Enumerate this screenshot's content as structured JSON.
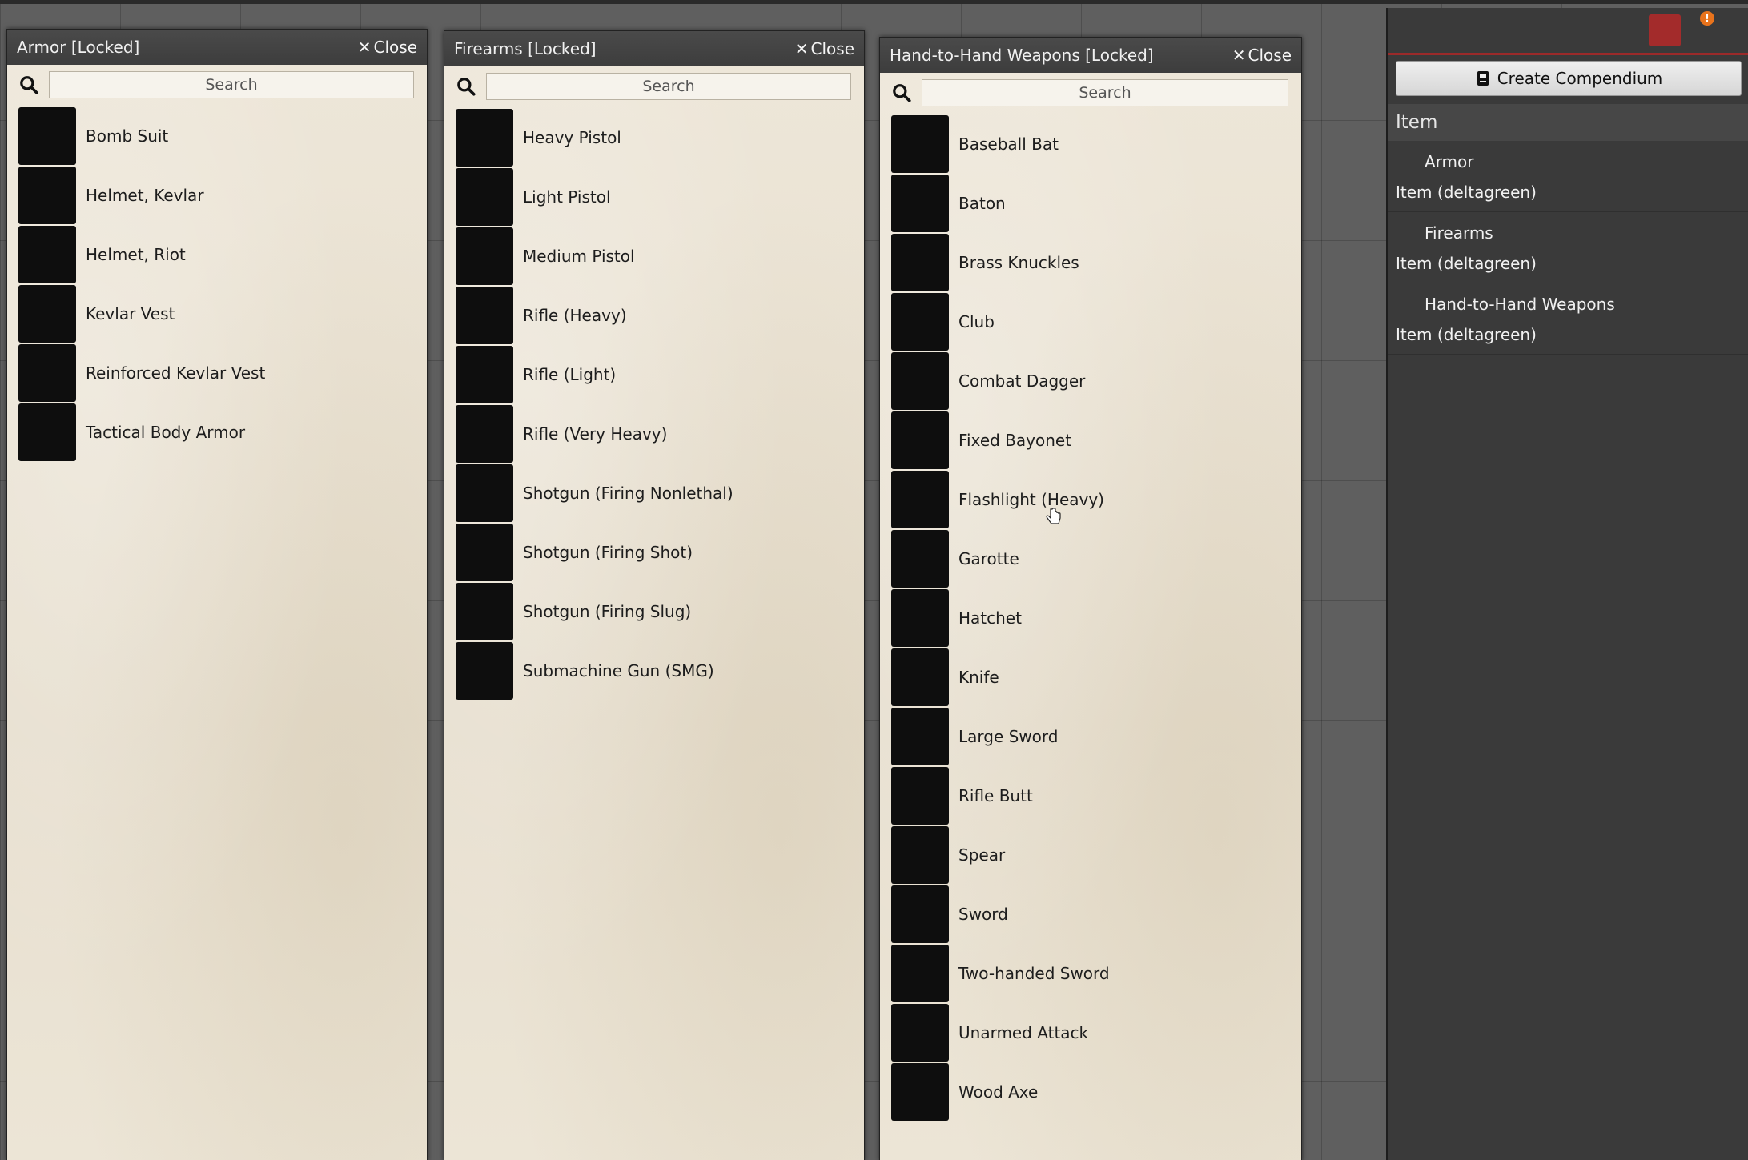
{
  "windows": {
    "armor": {
      "title": "Armor [Locked]",
      "close_label": "Close",
      "search_placeholder": "Search",
      "items": [
        {
          "label": "Bomb Suit",
          "icon": "bomb-suit-icon"
        },
        {
          "label": "Helmet, Kevlar",
          "icon": "helmet-icon"
        },
        {
          "label": "Helmet, Riot",
          "icon": "helmet-icon"
        },
        {
          "label": "Kevlar Vest",
          "icon": "vest-icon"
        },
        {
          "label": "Reinforced Kevlar Vest",
          "icon": "armored-vest-icon"
        },
        {
          "label": "Tactical Body Armor",
          "icon": "armored-vest-icon"
        }
      ]
    },
    "firearms": {
      "title": "Firearms [Locked]",
      "close_label": "Close",
      "search_placeholder": "Search",
      "items": [
        {
          "label": "Heavy Pistol",
          "icon": "pistol-icon"
        },
        {
          "label": "Light Pistol",
          "icon": "pistol-icon"
        },
        {
          "label": "Medium Pistol",
          "icon": "pistol-icon"
        },
        {
          "label": "Rifle (Heavy)",
          "icon": "rifle-icon"
        },
        {
          "label": "Rifle (Light)",
          "icon": "assault-rifle-icon"
        },
        {
          "label": "Rifle (Very Heavy)",
          "icon": "assault-rifle-icon"
        },
        {
          "label": "Shotgun (Firing Nonlethal)",
          "icon": "shotgun-icon"
        },
        {
          "label": "Shotgun (Firing Shot)",
          "icon": "shotgun-icon"
        },
        {
          "label": "Shotgun (Firing Slug)",
          "icon": "shotgun-icon"
        },
        {
          "label": "Submachine Gun (SMG)",
          "icon": "smg-icon"
        }
      ]
    },
    "melee": {
      "title": "Hand-to-Hand Weapons [Locked]",
      "close_label": "Close",
      "search_placeholder": "Search",
      "items": [
        {
          "label": "Baseball Bat",
          "icon": "bat-icon"
        },
        {
          "label": "Baton",
          "icon": "baton-icon"
        },
        {
          "label": "Brass Knuckles",
          "icon": "brass-knuckles-icon"
        },
        {
          "label": "Club",
          "icon": "club-icon"
        },
        {
          "label": "Combat Dagger",
          "icon": "dagger-icon"
        },
        {
          "label": "Fixed Bayonet",
          "icon": "bayonet-icon"
        },
        {
          "label": "Flashlight (Heavy)",
          "icon": "flashlight-icon"
        },
        {
          "label": "Garotte",
          "icon": "garotte-icon"
        },
        {
          "label": "Hatchet",
          "icon": "hatchet-icon"
        },
        {
          "label": "Knife",
          "icon": "knife-icon"
        },
        {
          "label": "Large Sword",
          "icon": "sword-icon"
        },
        {
          "label": "Rifle Butt",
          "icon": "rifle-butt-icon"
        },
        {
          "label": "Spear",
          "icon": "spear-icon"
        },
        {
          "label": "Sword",
          "icon": "sword-icon"
        },
        {
          "label": "Two-handed Sword",
          "icon": "sword-icon"
        },
        {
          "label": "Unarmed Attack",
          "icon": "fist-icon"
        },
        {
          "label": "Wood Axe",
          "icon": "axe-icon"
        }
      ]
    }
  },
  "sidebar": {
    "tools": [
      {
        "name": "chat-tab",
        "icon": "chat-icon"
      },
      {
        "name": "art-tab",
        "icon": "hand-icon"
      },
      {
        "name": "map-tab",
        "icon": "map-icon"
      },
      {
        "name": "characters-tab",
        "icon": "people-icon"
      },
      {
        "name": "inventory-tab",
        "icon": "bag-icon"
      },
      {
        "name": "journal-tab",
        "icon": "book-icon"
      },
      {
        "name": "tables-tab",
        "icon": "table-icon"
      },
      {
        "name": "music-tab",
        "icon": "music-icon"
      },
      {
        "name": "compendium-tab",
        "icon": "compendium-icon",
        "active": true
      },
      {
        "name": "settings-tab",
        "icon": "gear-icon",
        "badge": "!"
      },
      {
        "name": "collapse-tab",
        "icon": "chevron-right-icon"
      }
    ],
    "create_label": "Create Compendium",
    "section_title": "Item",
    "packs": [
      {
        "name": "Armor",
        "subtitle": "Item (deltagreen)"
      },
      {
        "name": "Firearms",
        "subtitle": "Item (deltagreen)"
      },
      {
        "name": "Hand-to-Hand Weapons",
        "subtitle": "Item (deltagreen)"
      }
    ]
  },
  "colors": {
    "accent": "#a32b2b",
    "badge": "#e8731c",
    "parchment": "#ebe4d5"
  }
}
